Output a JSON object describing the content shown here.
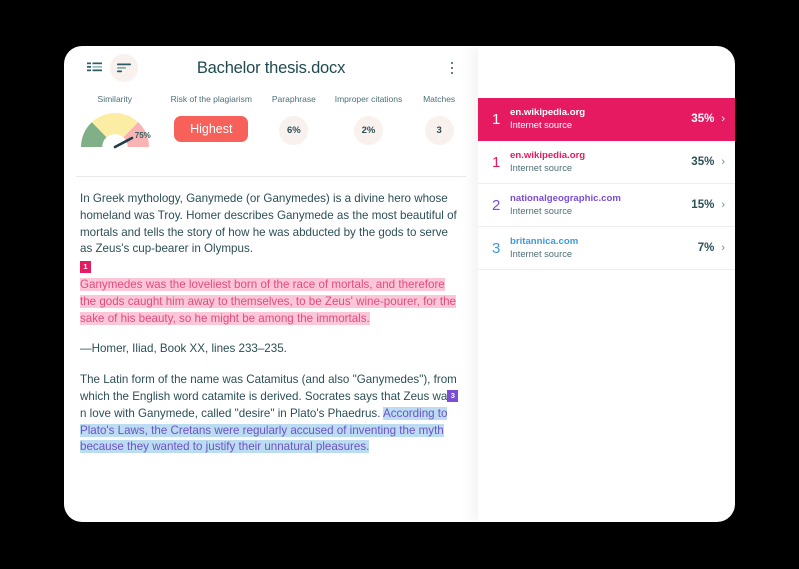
{
  "header": {
    "title": "Bachelor thesis.docx",
    "view_icon_1": "list-view-icon",
    "view_icon_2": "sorted-list-view-icon",
    "menu_icon": "kebab-menu-icon"
  },
  "metrics": {
    "similarity": {
      "label": "Similarity",
      "value": "75%",
      "gauge": {
        "green_color": "#7fb087",
        "yellow_color": "#fbeda3",
        "pink_color": "#f8b3b3",
        "needle_color": "#1f3d45",
        "needle_pct": 75
      }
    },
    "risk": {
      "label": "Risk of the plagiarism",
      "value": "Highest",
      "color": "#f8605a"
    },
    "paraphrase": {
      "label": "Paraphrase",
      "value": "6%"
    },
    "improper_citations": {
      "label": "Improper citations",
      "value": "2%"
    },
    "matches": {
      "label": "Matches",
      "value": "3"
    }
  },
  "document": {
    "paragraph_1": "In Greek mythology, Ganymede (or Ganymedes) is a divine hero whose homeland was Troy. Homer describes Ganymede as the most beautiful of mortals and tells the story of how he was abducted by the gods to serve as Zeus's cup-bearer in Olympus.",
    "quote_badge": "1",
    "quote_text": "Ganymedes was the loveliest born of the race of mortals, and therefore the gods caught him away to themselves, to be Zeus' wine-pourer, for the sake of his beauty, so he might be among the immortals.",
    "attribution": "—Homer, Iliad, Book XX, lines 233–235.",
    "paragraph_3_part1": "The Latin form of the name was Catamitus (and also \"Ganymedes\"), from which the English word catamite is derived. Socrates says that Zeus wa",
    "paragraph_3_badge": "3",
    "paragraph_3_part2": "n love with Ganymede, called \"desire\" in Plato's Phaedrus. ",
    "paragraph_3_highlight": "According to Plato's Laws, the Cretans were regularly accused of inventing the myth because they wanted to justify their unnatural pleasures."
  },
  "sources": {
    "chevron_icon": "chevron-right-icon",
    "items": [
      {
        "rank": "1",
        "name": "en.wikipedia.org",
        "type": "Internet source",
        "percent": "35%",
        "name_color": "#ffffff",
        "rank_color": "#ffffff",
        "selected": true
      },
      {
        "rank": "1",
        "name": "en.wikipedia.org",
        "type": "Internet source",
        "percent": "35%",
        "name_color": "#e61a61",
        "rank_color": "#e61a61",
        "selected": false
      },
      {
        "rank": "2",
        "name": "nationalgeographic.com",
        "type": "Internet source",
        "percent": "15%",
        "name_color": "#7a4ed6",
        "rank_color": "#7a4ed6",
        "selected": false
      },
      {
        "rank": "3",
        "name": "britannica.com",
        "type": "Internet source",
        "percent": "7%",
        "name_color": "#3e9bdd",
        "rank_color": "#3e9bdd",
        "selected": false
      }
    ]
  }
}
